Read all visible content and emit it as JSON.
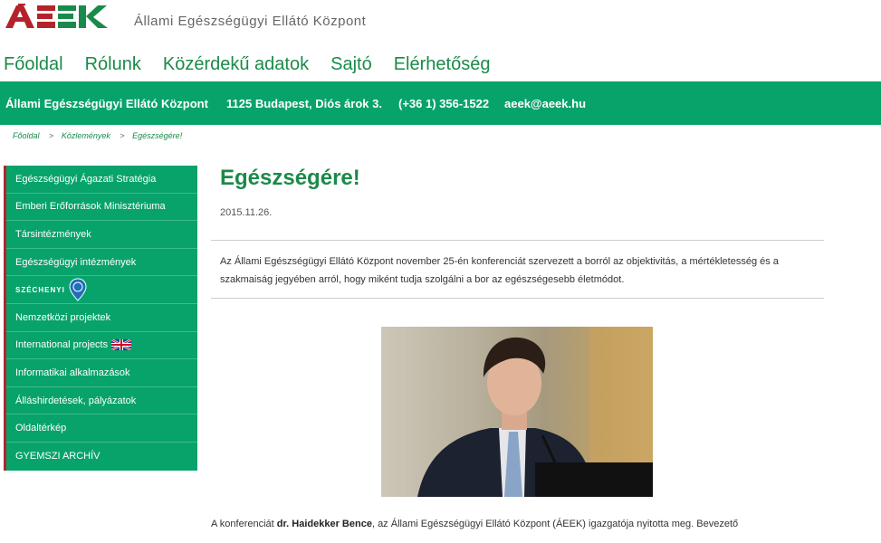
{
  "header": {
    "logo_text": "ÁEEK",
    "org_name": "Állami Egészségügyi Ellátó Központ"
  },
  "main_nav": [
    {
      "label": "Főoldal"
    },
    {
      "label": "Rólunk"
    },
    {
      "label": "Közérdekű adatok"
    },
    {
      "label": "Sajtó"
    },
    {
      "label": "Elérhetőség"
    }
  ],
  "contact_bar": {
    "org": "Állami Egészségügyi Ellátó Központ",
    "address": "1125 Budapest, Diós árok 3.",
    "phone": "(+36 1) 356-1522",
    "email": "aeek@aeek.hu"
  },
  "breadcrumb": [
    "Főoldal",
    "Közlemények",
    "Egészségére!"
  ],
  "breadcrumb_sep": ">",
  "sidebar": [
    {
      "label": "Egészségügyi Ágazati Stratégia"
    },
    {
      "label": "Emberi Erőforrások Minisztériuma"
    },
    {
      "label": "Társintézmények"
    },
    {
      "label": "Egészségügyi intézmények"
    },
    {
      "label": "SZÉCHENYI"
    },
    {
      "label": "Nemzetközi projektek"
    },
    {
      "label": "International projects"
    },
    {
      "label": "Informatikai alkalmazások"
    },
    {
      "label": "Álláshirdetések, pályázatok"
    },
    {
      "label": "Oldaltérkép"
    },
    {
      "label": "GYEMSZI ARCHÍV"
    }
  ],
  "article": {
    "title": "Egészségére!",
    "date": "2015.11.26.",
    "lead": "Az Állami Egészségügyi Ellátó Központ november 25-én konferenciát szervezett a borról az objektivitás, a mértékletesség és a szakmaiság jegyében arról, hogy miként tudja szolgálni a bor az egészségesebb életmódot.",
    "body_prefix": "A konferenciát ",
    "body_name": "dr. Haidekker Bence",
    "body_rest": ", az Állami Egészségügyi Ellátó Központ (ÁEEK) igazgatója nyitotta meg. Bevezető"
  },
  "colors": {
    "brand_green": "#07a36b",
    "nav_green": "#1a8a4a",
    "logo_red": "#b5232a"
  }
}
